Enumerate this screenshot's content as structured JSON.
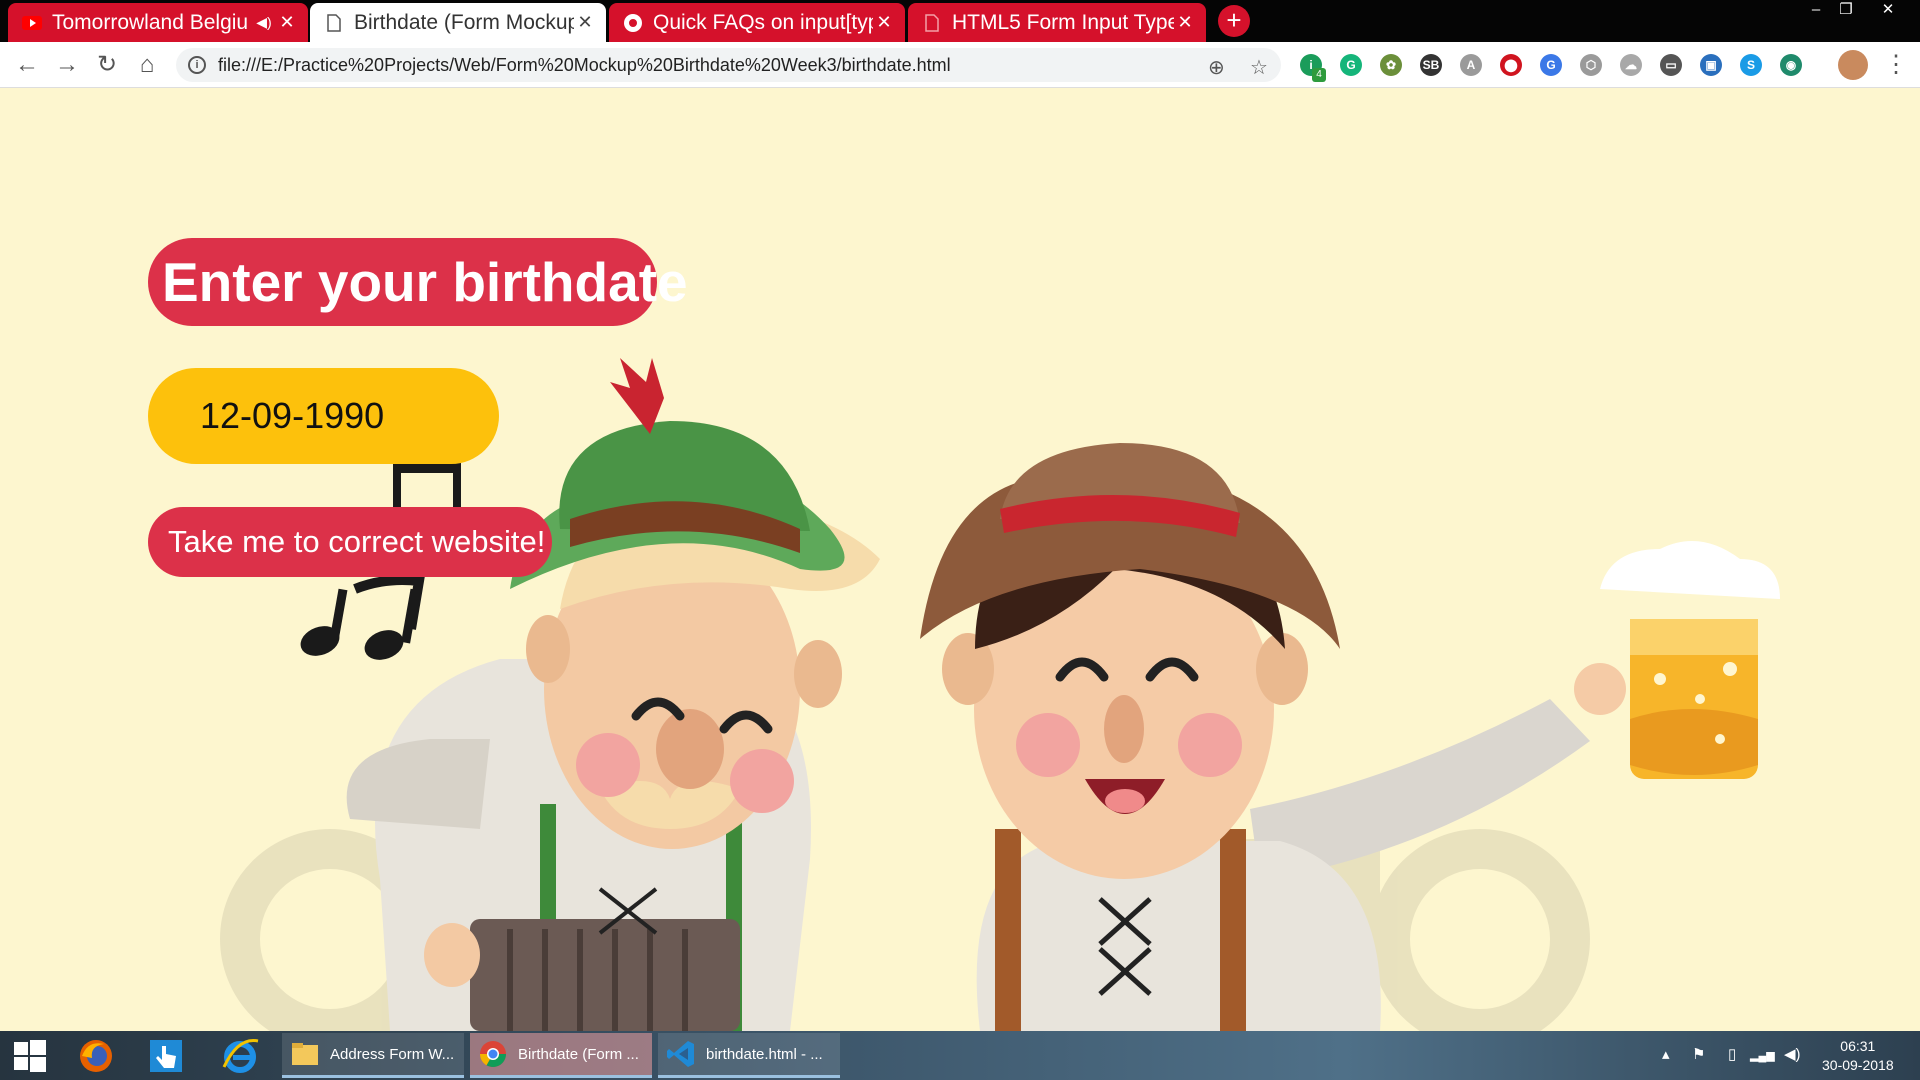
{
  "browser": {
    "tabs": [
      {
        "title": "Tomorrowland Belgiu",
        "state": "background",
        "favicon": "youtube-icon",
        "muted_icon": "speaker-icon"
      },
      {
        "title": "Birthdate (Form Mockup",
        "state": "active",
        "favicon": "page-icon"
      },
      {
        "title": "Quick FAQs on input[typ",
        "state": "background",
        "favicon": "chrome-icon"
      },
      {
        "title": "HTML5 Form Input Type",
        "state": "background",
        "favicon": "page-icon"
      }
    ],
    "close_glyph": "✕",
    "new_tab_glyph": "+",
    "window_controls": [
      "–",
      "❐",
      "✕"
    ],
    "address_bar": {
      "url": "file:///E:/Practice%20Projects/Web/Form%20Mockup%20Birthdate%20Week3/birthdate.html",
      "info_glyph": "i"
    },
    "nav": {
      "back": "←",
      "forward": "→",
      "reload": "↻",
      "home": "⌂"
    },
    "omni_icons": {
      "zoom": "⊕",
      "bookmark": "☆"
    },
    "extensions": [
      {
        "name": "badge-extension-icon",
        "glyph": "i",
        "color": "#1a9c5a",
        "badge": "4"
      },
      {
        "name": "grammarly-icon",
        "glyph": "G",
        "color": "#15b57a"
      },
      {
        "name": "plant-extension-icon",
        "glyph": "✿",
        "color": "#6b8f3a"
      },
      {
        "name": "sb-extension-icon",
        "glyph": "SB",
        "color": "#333333"
      },
      {
        "name": "font-extension-icon",
        "glyph": "A",
        "color": "#9a9a9a"
      },
      {
        "name": "adblock-icon",
        "glyph": "⬤",
        "color": "#d0141f"
      },
      {
        "name": "translate-icon",
        "glyph": "G",
        "color": "#3b78e7"
      },
      {
        "name": "cube-extension-icon",
        "glyph": "⬡",
        "color": "#9a9a9a"
      },
      {
        "name": "cloud-extension-icon",
        "glyph": "☁",
        "color": "#a8a8a8"
      },
      {
        "name": "cast-icon",
        "glyph": "▭",
        "color": "#555555"
      },
      {
        "name": "screenshot-extension-icon",
        "glyph": "▣",
        "color": "#2a6fbd"
      },
      {
        "name": "skype-icon",
        "glyph": "S",
        "color": "#1a9be6"
      },
      {
        "name": "globe-extension-icon",
        "glyph": "◉",
        "color": "#1f8a6b"
      }
    ],
    "menu_glyph": "⋮"
  },
  "page": {
    "heading": "Enter your birthdate",
    "date_input": {
      "value": "12-09-1990"
    },
    "submit_button": "Take me to correct website!",
    "colors": {
      "background": "#fdf6cf",
      "pill_red": "#dc3149",
      "pill_yellow": "#fdc10c"
    }
  },
  "taskbar": {
    "apps": [
      {
        "label": "Address Form W...",
        "icon": "folder-icon",
        "active": false
      },
      {
        "label": "Birthdate (Form ...",
        "icon": "chrome-icon",
        "active": true
      },
      {
        "label": "birthdate.html - ...",
        "icon": "vscode-icon",
        "active": false
      }
    ],
    "clock": {
      "time": "06:31",
      "date": "30-09-2018"
    },
    "tray_glyphs": {
      "chevron": "▴",
      "flag": "⚑",
      "battery": "▯",
      "wifi": "▂▄▆",
      "volume": "◀)"
    }
  }
}
